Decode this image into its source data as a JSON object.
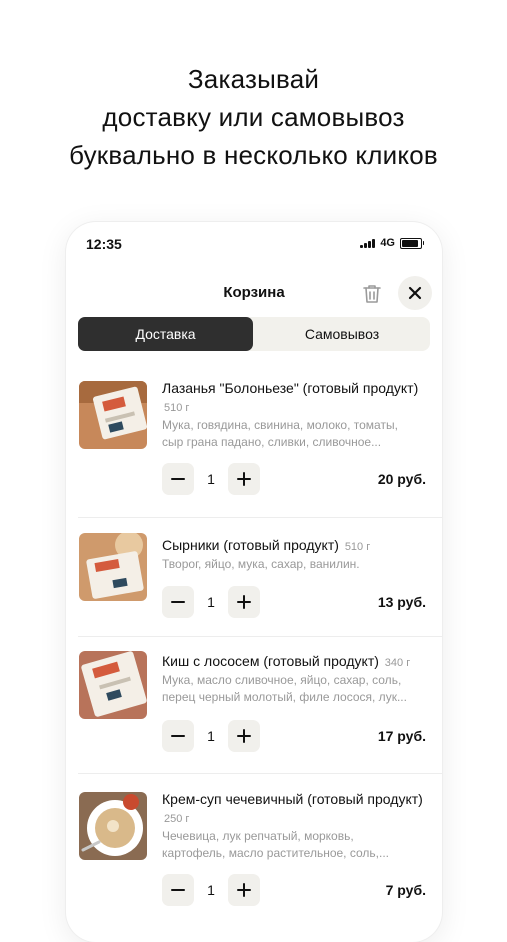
{
  "headline": [
    "Заказывай",
    "доставку или самовывоз",
    "буквально в несколько кликов"
  ],
  "status": {
    "time": "12:35",
    "network": "4G"
  },
  "header": {
    "title": "Корзина"
  },
  "tabs": [
    {
      "label": "Доставка",
      "active": true
    },
    {
      "label": "Самовывоз",
      "active": false
    }
  ],
  "items": [
    {
      "name": "Лазанья \"Болоньезе\" (готовый продукт)",
      "weight": "510 г",
      "desc_lines": [
        "Мука, говядина, свинина, молоко, томаты,",
        "сыр грана падано, сливки, сливочное..."
      ],
      "quantity": "1",
      "price": "20 руб."
    },
    {
      "name": "Сырники (готовый продукт)",
      "weight": "510 г",
      "desc_lines": [
        "Творог, яйцо, мука, сахар, ванилин."
      ],
      "quantity": "1",
      "price": "13 руб."
    },
    {
      "name": "Киш с лососем (готовый продукт)",
      "weight": "340 г",
      "desc_lines": [
        "Мука, масло сливочное, яйцо, сахар, соль,",
        "перец черный молотый, филе лосося, лук..."
      ],
      "quantity": "1",
      "price": "17 руб."
    },
    {
      "name": "Крем-суп чечевичный (готовый продукт)",
      "weight": "250 г",
      "desc_lines": [
        "Чечевица, лук репчатый, морковь,",
        "картофель, масло растительное, соль,..."
      ],
      "quantity": "1",
      "price": "7 руб."
    }
  ],
  "icons": {
    "trash": "trash-icon",
    "close": "close-icon",
    "minus": "minus-icon",
    "plus": "plus-icon"
  },
  "colors": {
    "active_tab": "#2f2f2f",
    "button_bg": "#f1f0ec",
    "muted_text": "#999999"
  }
}
